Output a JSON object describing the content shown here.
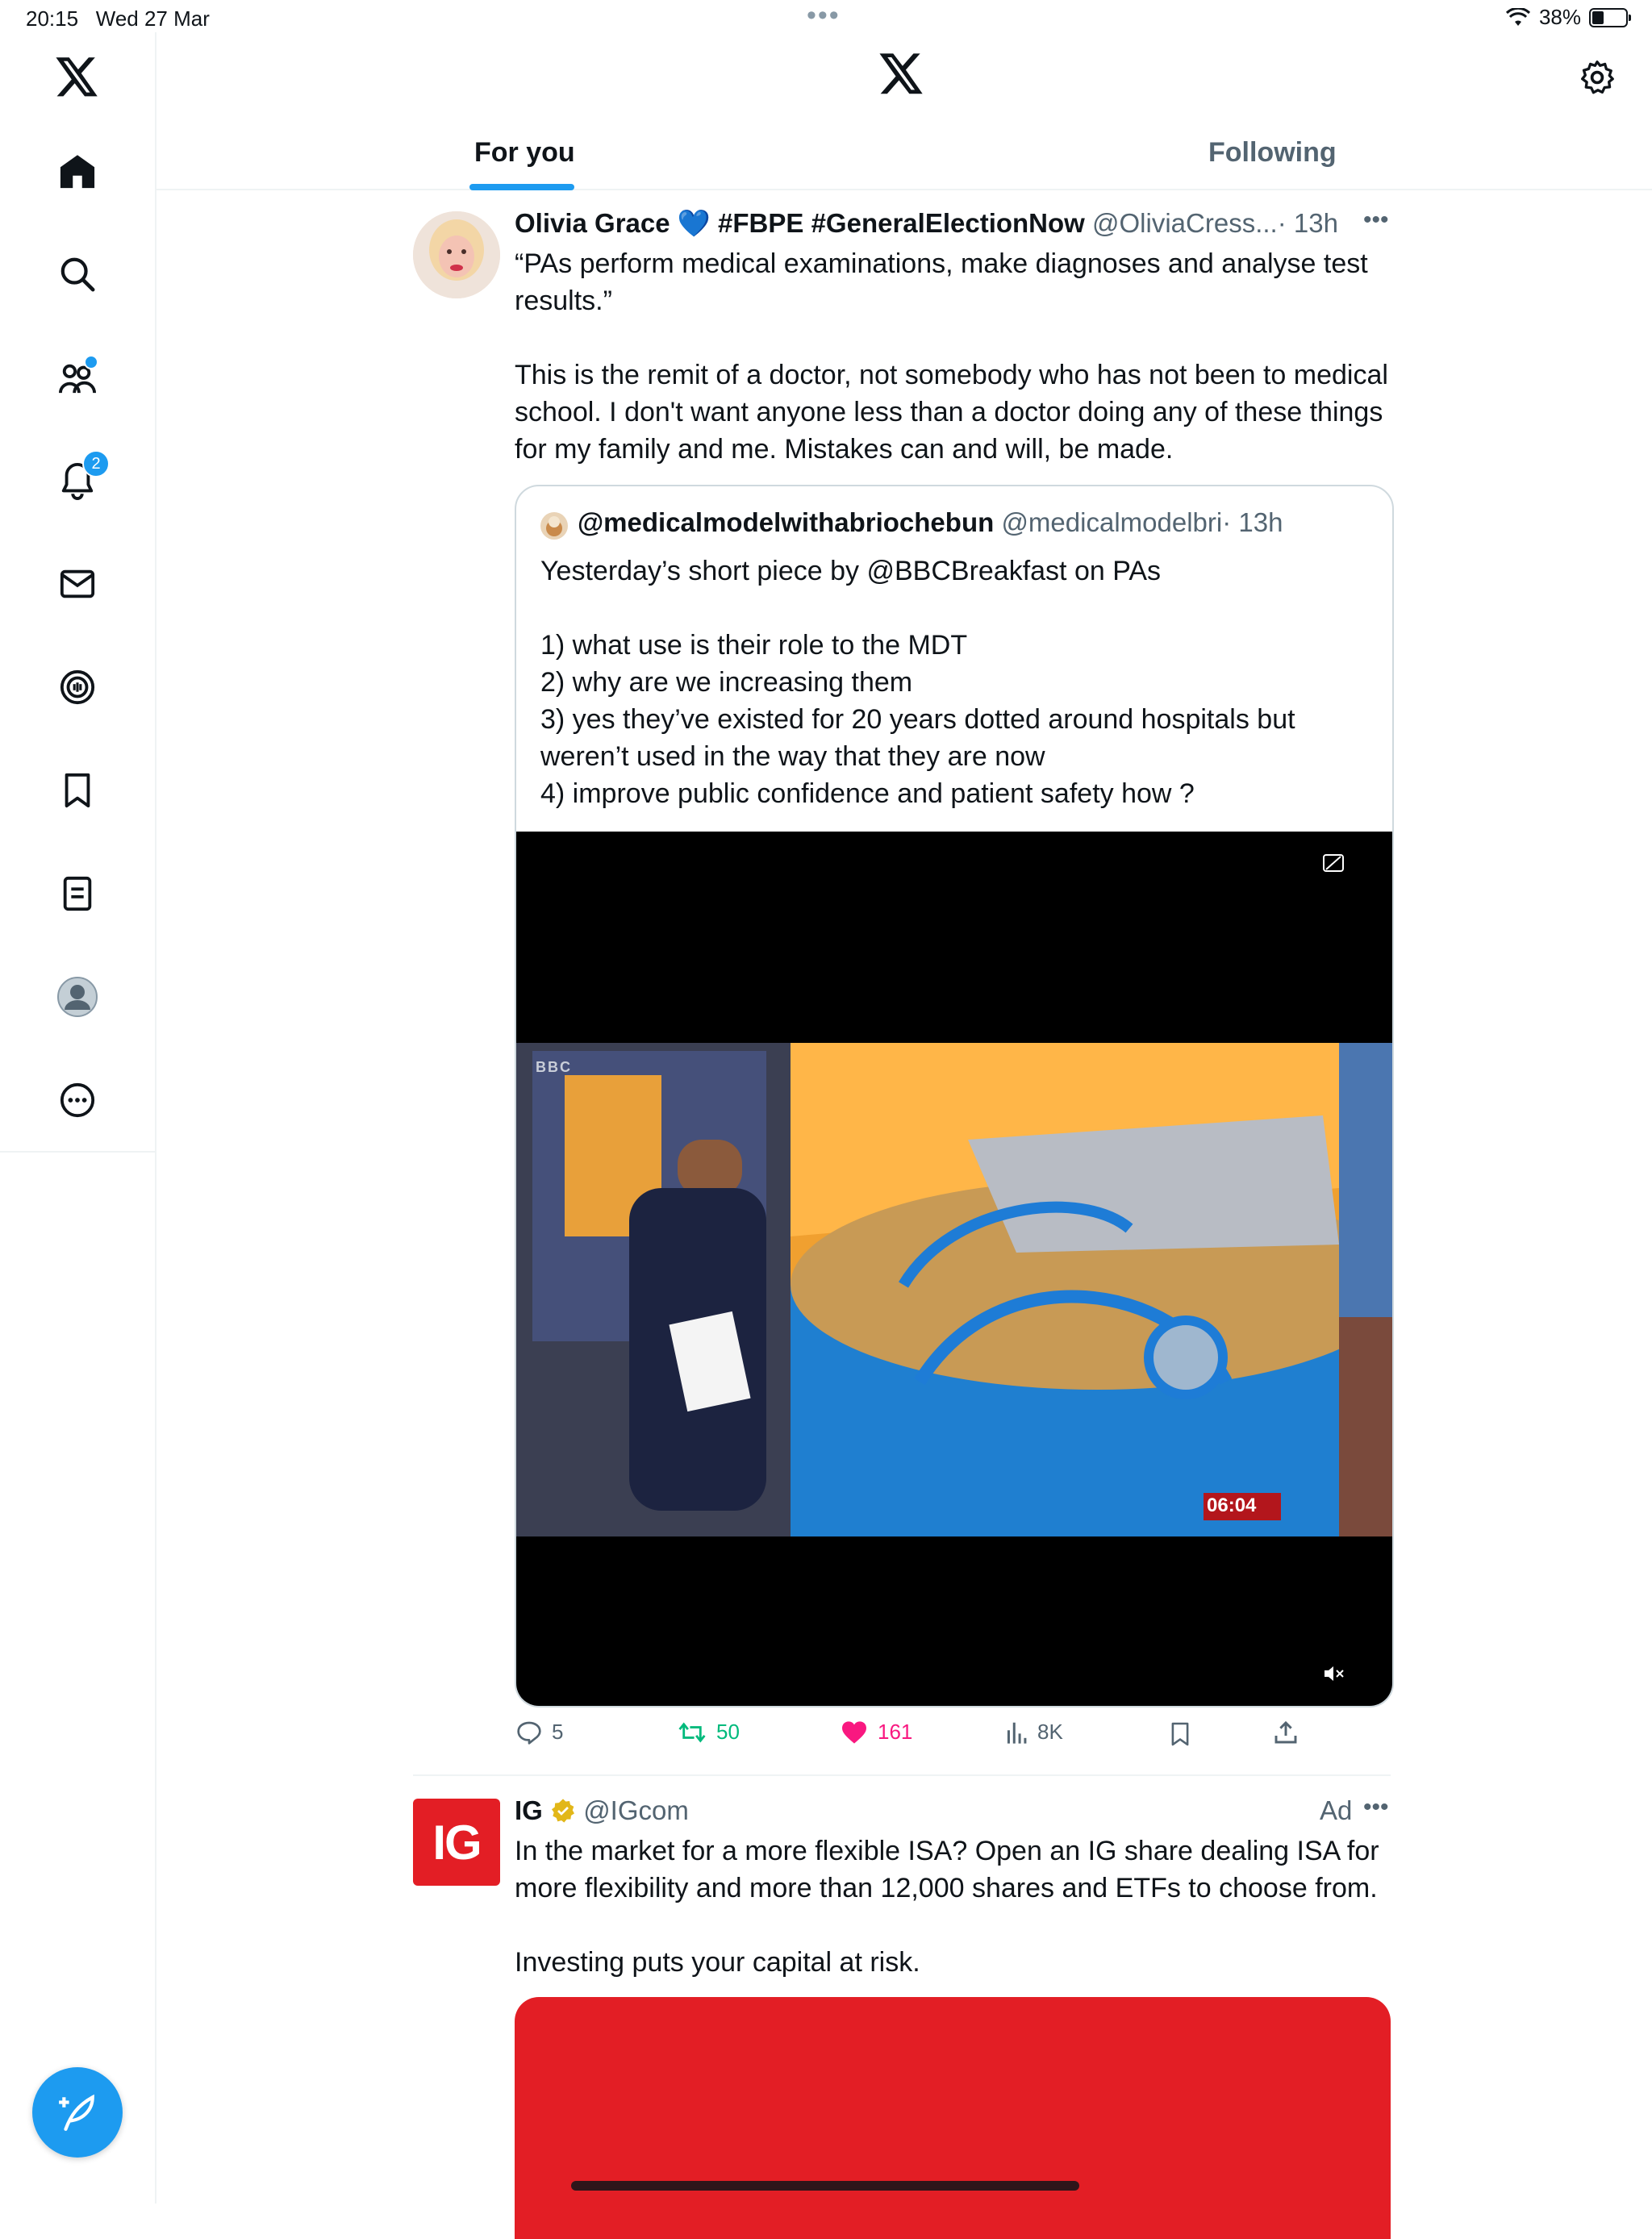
{
  "status_bar": {
    "time": "20:15",
    "date": "Wed 27 Mar",
    "battery": "38%"
  },
  "sidebar": {
    "items": [
      "home-icon",
      "search-icon",
      "communities-icon",
      "notifications-icon",
      "messages-icon",
      "spaces-icon",
      "bookmarks-icon",
      "lists-icon",
      "profile-icon",
      "more-icon"
    ],
    "notification_count": "2"
  },
  "header": {
    "tabs": [
      "For you",
      "Following"
    ],
    "active_tab": "For you"
  },
  "tweets": [
    {
      "name": "Olivia Grace 💙 #FBPE #GeneralElectionNow",
      "handle": "@OliviaCress...",
      "time": "· 13h",
      "text": "“PAs perform medical examinations, make diagnoses and analyse test results.”\n\nThis is the remit of a doctor, not somebody who has not been to medical school. I don't want anyone less than a doctor doing any of these things for my family and me. Mistakes can and will, be made.",
      "quote": {
        "name": "@medicalmodelwithabriochebun",
        "handle": "@medicalmodelbri",
        "time": "· 13h",
        "text": "Yesterday’s short piece by @BBCBreakfast on PAs\n\n1) what use is their role to the MDT\n2) why are we increasing them\n3) yes they’ve existed for 20 years dotted around hospitals but weren’t used in the way that they are now\n4) improve public confidence and patient safety how ?",
        "video_timestamp": "06:04",
        "video_watermark": "BBC"
      },
      "stats": {
        "replies": "5",
        "reposts": "50",
        "likes": "161",
        "views": "8K"
      }
    },
    {
      "name": "IG",
      "handle": "@IGcom",
      "ad_label": "Ad",
      "avatar_text": "IG",
      "text": "In the market for a more flexible ISA? Open an IG share dealing ISA for more flexibility and more than 12,000 shares and ETFs to choose from.\n\nInvesting puts your capital at risk."
    }
  ],
  "colors": {
    "accent": "#1d9bf0",
    "like": "#f91880",
    "repost": "#00ba7c",
    "ig_red": "#e31e25"
  }
}
